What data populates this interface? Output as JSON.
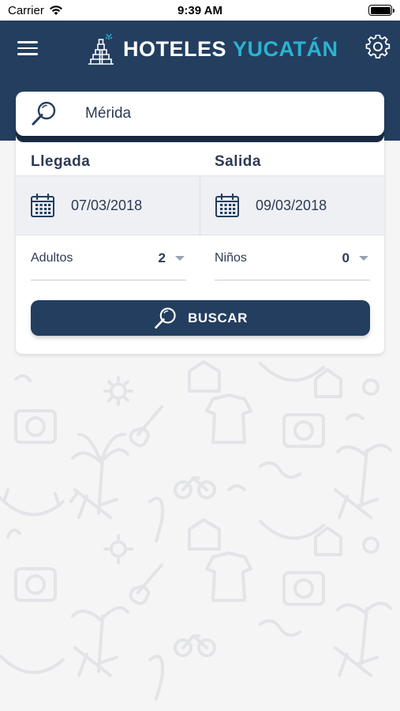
{
  "status_bar": {
    "carrier": "Carrier",
    "time": "9:39 AM"
  },
  "header": {
    "logo_word_1": "HOTELES",
    "logo_word_2": "YUCATÁN",
    "icons": {
      "menu": "hamburger-menu-icon",
      "settings": "gear-icon",
      "logo": "pyramid-logo-icon"
    }
  },
  "search": {
    "value": "Mérida",
    "icon": "search-icon"
  },
  "form": {
    "arrival_label": "Llegada",
    "departure_label": "Salida",
    "arrival_date": "07/03/2018",
    "departure_date": "09/03/2018",
    "adults_label": "Adultos",
    "adults_value": "2",
    "children_label": "Niños",
    "children_value": "0",
    "search_button_label": "BUSCAR"
  },
  "colors": {
    "header_bg": "#233e5f",
    "logo_accent": "#2ab3cf",
    "text": "#2c3a55",
    "button_bg": "#233e5f"
  }
}
